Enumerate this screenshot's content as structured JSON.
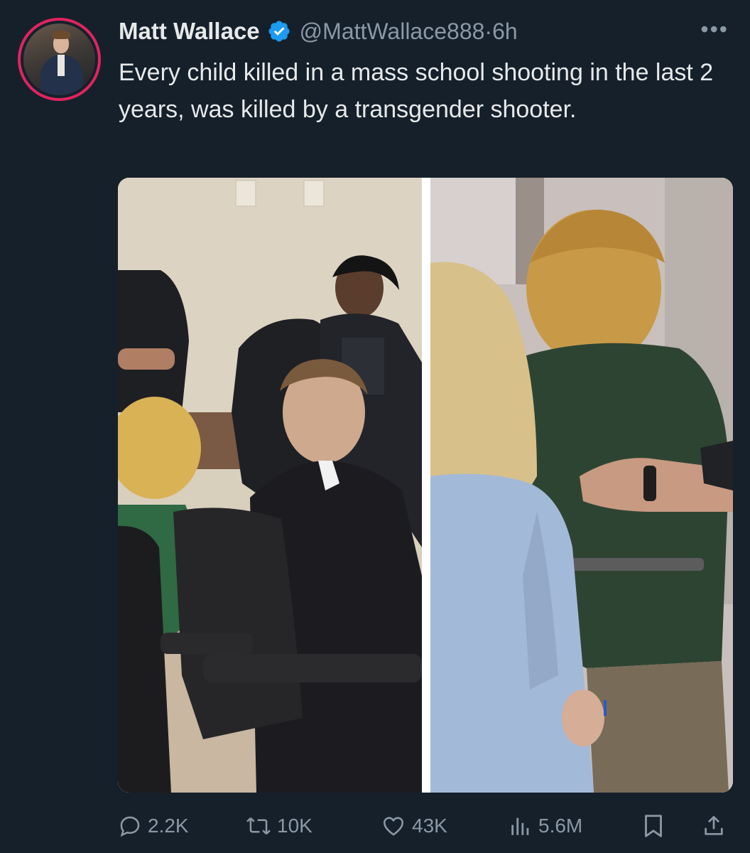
{
  "tweet": {
    "author_name": "Matt Wallace",
    "handle": "@MattWallace888",
    "separator": "·",
    "time": "6h",
    "verified": true,
    "text": "Every child killed in a mass school shooting in the last 2 years, was killed by a transgender shooter.",
    "more_icon": "more-horizontal-icon"
  },
  "media": {
    "panels": [
      "courtroom-photo-left",
      "courtroom-photo-right"
    ]
  },
  "actions": {
    "replies": "2.2K",
    "retweets": "10K",
    "likes": "43K",
    "views": "5.6M"
  },
  "colors": {
    "background": "#15202b",
    "text": "#e7e9ea",
    "muted": "#8b98a5",
    "verified": "#1d9bf0",
    "avatar_ring": "#e0245e"
  }
}
